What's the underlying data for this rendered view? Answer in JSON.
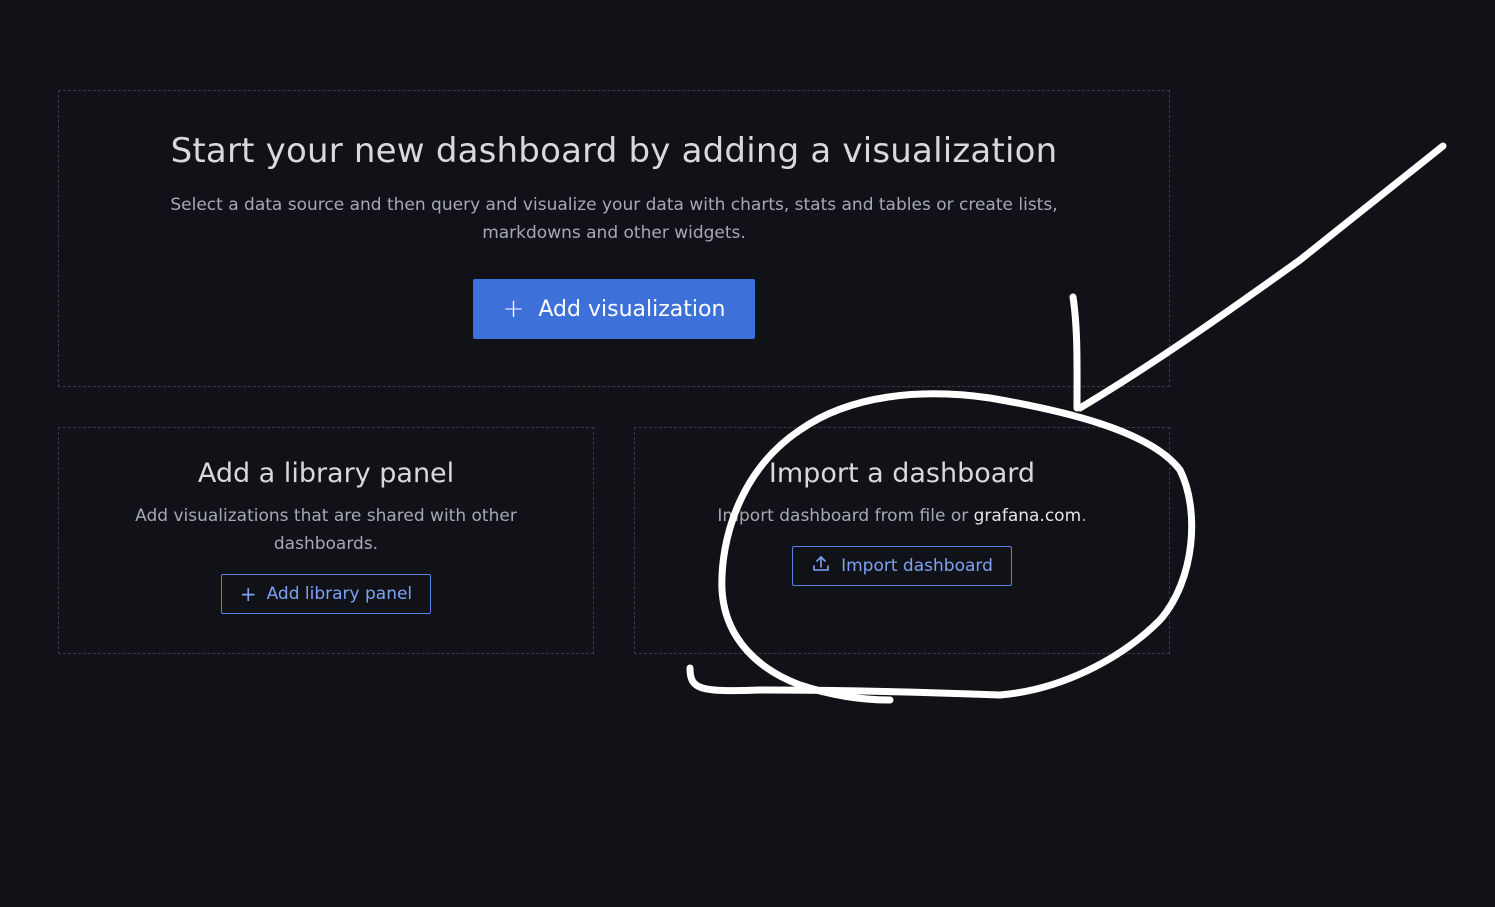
{
  "main_card": {
    "title": "Start your new dashboard by adding a visualization",
    "description": "Select a data source and then query and visualize your data with charts, stats and tables or create lists, markdowns and other widgets.",
    "button_label": "Add visualization",
    "button_icon": "plus-icon"
  },
  "library_card": {
    "title": "Add a library panel",
    "description": "Add visualizations that are shared with other dashboards.",
    "button_label": "Add library panel",
    "button_icon": "plus-icon"
  },
  "import_card": {
    "title": "Import a dashboard",
    "description_prefix": "Import dashboard from file or ",
    "description_link": "grafana.com",
    "description_suffix": ".",
    "button_label": "Import dashboard",
    "button_icon": "upload-icon"
  },
  "colors": {
    "background": "#111217",
    "primary": "#3d71d9",
    "outline_text": "#7ea2f2",
    "annotation": "#ffffff"
  }
}
